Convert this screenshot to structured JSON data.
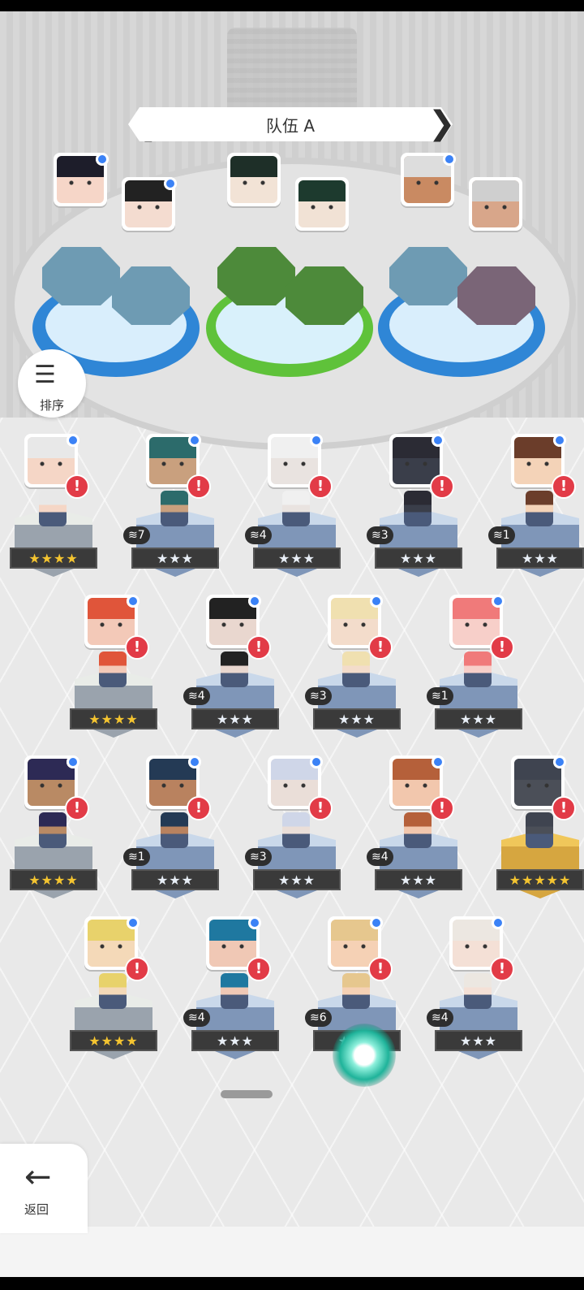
{
  "team": {
    "title": "队伍 A"
  },
  "buttons": {
    "sort_label": "排序",
    "back_label": "返回"
  },
  "colors": {
    "alert": "#e23b47",
    "badge_blue": "#3b82f6",
    "gold_star": "#f4c430"
  },
  "roster": [
    {
      "stars": "★★★★",
      "count": "",
      "gold": true
    },
    {
      "stars": "★★★",
      "count": "7"
    },
    {
      "stars": "★★★",
      "count": "4"
    },
    {
      "stars": "★★★",
      "count": "3"
    },
    {
      "stars": "★★★",
      "count": "1"
    },
    {
      "stars": "★★★★",
      "count": "",
      "gold": true
    },
    {
      "stars": "★★★",
      "count": "4"
    },
    {
      "stars": "★★★",
      "count": "3"
    },
    {
      "stars": "★★★",
      "count": "1"
    },
    {
      "stars": "★★★★",
      "count": "",
      "gold": true
    },
    {
      "stars": "★★★",
      "count": "1"
    },
    {
      "stars": "★★★",
      "count": "3"
    },
    {
      "stars": "★★★",
      "count": "4"
    },
    {
      "stars": "★★★★★",
      "count": "",
      "gold": true
    },
    {
      "stars": "★★★★",
      "count": "",
      "gold": true
    },
    {
      "stars": "★★★",
      "count": "4"
    },
    {
      "stars": "★★★",
      "count": "6"
    },
    {
      "stars": "★★★",
      "count": "4"
    }
  ]
}
